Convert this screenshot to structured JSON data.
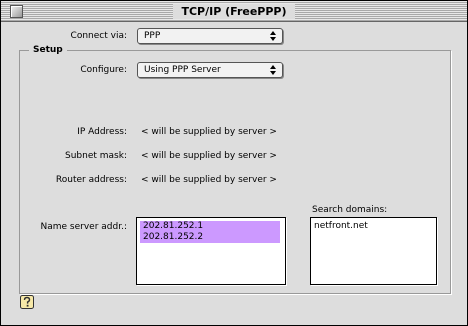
{
  "window": {
    "title": "TCP/IP (FreePPP)"
  },
  "connect": {
    "label": "Connect via:",
    "value": "PPP"
  },
  "setup": {
    "title": "Setup",
    "configure_label": "Configure:",
    "configure_value": "Using PPP Server",
    "ip_label": "IP Address:",
    "ip_value": "< will be supplied by server >",
    "subnet_label": "Subnet mask:",
    "subnet_value": "< will be supplied by server >",
    "router_label": "Router address:",
    "router_value": "< will be supplied by server >",
    "nameserver_label": "Name server addr.:",
    "nameservers": [
      "202.81.252.1",
      "202.81.252.2"
    ],
    "search_domains_label": "Search domains:",
    "search_domains": [
      "netfront.net"
    ]
  },
  "colors": {
    "selection": "#cc99ff",
    "window_bg": "#dddddd"
  },
  "icons": {
    "help": "help-question-icon",
    "close": "close-box-icon",
    "popup": "popup-arrows-icon"
  }
}
